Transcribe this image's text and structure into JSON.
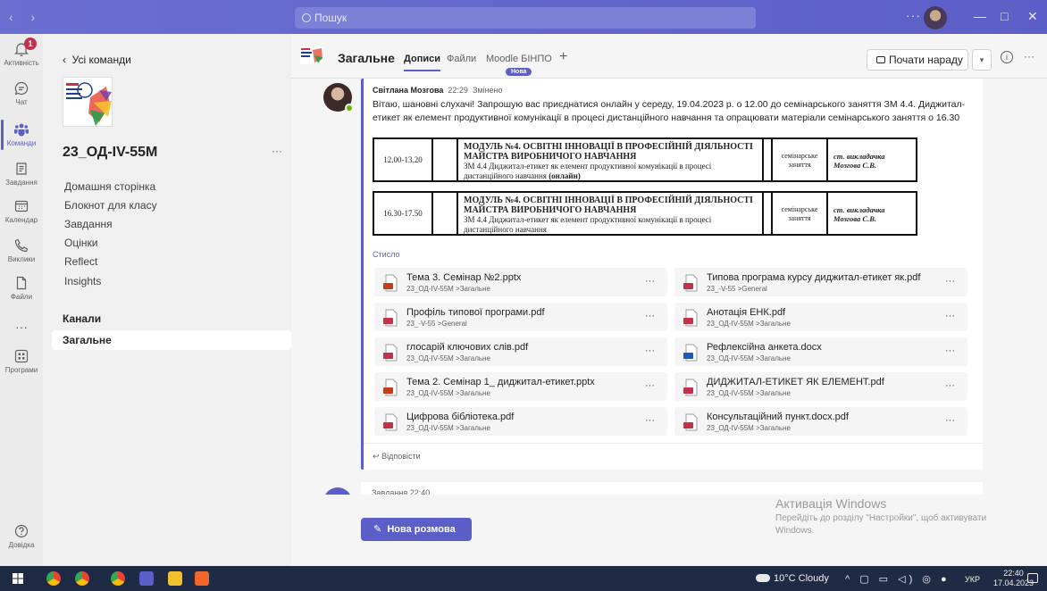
{
  "titlebar": {
    "search_placeholder": "Пошук",
    "nav_arrows": "‹ ›",
    "more": "···",
    "minimize": "—",
    "maximize": "□",
    "close": "✕"
  },
  "rail": [
    {
      "label": "Активність",
      "icon": "bell-icon",
      "badge": "1"
    },
    {
      "label": "Чат",
      "icon": "chat-icon"
    },
    {
      "label": "Команди",
      "icon": "teams-icon",
      "active": true
    },
    {
      "label": "Завдання",
      "icon": "assignments-icon"
    },
    {
      "label": "Календар",
      "icon": "calendar-icon"
    },
    {
      "label": "Виклики",
      "icon": "phone-icon"
    },
    {
      "label": "Файли",
      "icon": "file-icon"
    },
    {
      "label": "···",
      "icon": "more-icon"
    },
    {
      "label": "Програми",
      "icon": "apps-icon"
    },
    {
      "label": "Довідка",
      "icon": "help-icon"
    }
  ],
  "team": {
    "back_label": "Усі команди",
    "name": "23_ОД-IV-55М",
    "more": "···",
    "links": [
      "Домашня сторінка",
      "Блокнот для класу",
      "Завдання",
      "Оцінки",
      "Reflect",
      "Insights"
    ],
    "channels_header": "Канали",
    "active_channel": "Загальне"
  },
  "header": {
    "title": "Загальне",
    "tabs": [
      {
        "label": "Дописи",
        "active": true
      },
      {
        "label": "Файли"
      },
      {
        "label": "Moodle БІНПО"
      }
    ],
    "new_badge": "Нова",
    "add_tab": "+",
    "meet_label": "Почати нараду",
    "info": "i",
    "more": "···"
  },
  "post": {
    "author": "Світлана Мозгова",
    "time": "22:29",
    "edited": "Змінено",
    "text": "Вітаю, шановні слухачі! Запрошую вас приєднатися онлайн у середу, 19.04.2023 р. о 12.00 до семінарського заняття ЗМ 4.4. Диджитал-етикет як елемент продуктивної комунікації в процесі дистанційного навчання та опрацювати матеріали семінарського заняття о 16.30",
    "schedule": [
      {
        "time": "12.00-13.20",
        "title": "МОДУЛЬ №4. ОСВІТНІ ІННОВАЦІЇ В ПРОФЕСІЙНІЙ ДІЯЛЬНОСТІ МАЙСТРА ВИРОБНИЧОГО НАВЧАННЯ",
        "desc": "ЗМ 4.4 Диджитал-етикет як елемент продуктивної комунікації в процесі дистанційного навчання",
        "desc_bold": "(онлайн)",
        "type": "семінарське заняття",
        "teacher": "ст. викладачка Мозгова С.В."
      },
      {
        "time": "16.30-17.50",
        "title": "МОДУЛЬ №4. ОСВІТНІ ІННОВАЦІЇ В ПРОФЕСІЙНІЙ ДІЯЛЬНОСТІ МАЙСТРА ВИРОБНИЧОГО НАВЧАННЯ",
        "desc": "ЗМ 4.4 Диджитал-етикет як елемент продуктивної комунікації в процесі дистанційного навчання",
        "desc_bold": "",
        "type": "семінарське заняття",
        "teacher": "ст. викладачка Мозгова С.В."
      }
    ],
    "collapse_label": "Стисло",
    "files": [
      {
        "name": "Тема 3. Семінар №2.pptx",
        "path": "23_ОД-IV-55М >Загальне",
        "kind": "pptx"
      },
      {
        "name": "Типова програма курсу диджитал-етикет як.pdf",
        "path": "23_-V-55 >General",
        "kind": "pdf"
      },
      {
        "name": "Профіль типової програми.pdf",
        "path": "23_-V-55 >General",
        "kind": "pdf"
      },
      {
        "name": "Анотація ЕНК.pdf",
        "path": "23_ОД-IV-55М >Загальне",
        "kind": "pdf"
      },
      {
        "name": "глосарій ключових слів.pdf",
        "path": "23_ОД-IV-55М >Загальне",
        "kind": "pdf"
      },
      {
        "name": "Рефлексійна анкета.docx",
        "path": "23_ОД-IV-55М >Загальне",
        "kind": "docx"
      },
      {
        "name": "Тема 2. Семінар 1_ диджитал-етикет.pptx",
        "path": "23_ОД-IV-55М >Загальне",
        "kind": "pptx"
      },
      {
        "name": "ДИДЖИТАЛ-ЕТИКЕТ ЯК ЕЛЕМЕНТ.pdf",
        "path": "23_ОД-IV-55М >Загальне",
        "kind": "pdf"
      },
      {
        "name": "Цифрова бібліотека.pdf",
        "path": "23_ОД-IV-55М >Загальне",
        "kind": "pdf"
      },
      {
        "name": "Консультаційний пункт.docx.pdf",
        "path": "23_ОД-IV-55М >Загальне",
        "kind": "pdf"
      }
    ],
    "file_more": "···",
    "reply_label": "Відповісти"
  },
  "post2": {
    "preview": "Завдання 22:40"
  },
  "new_conversation_label": "Нова розмова",
  "watermark": {
    "title": "Активація Windows",
    "subtitle": "Перейдіть до розділу \"Настройки\", щоб активувати Windows."
  },
  "taskbar": {
    "weather": "10°C Cloudy",
    "lang": "УКР",
    "time": "22:40",
    "date": "17.04.2023"
  },
  "colors": {
    "accent": "#5b5fc7",
    "pdf": "#c4314b",
    "pptx": "#c43e1c",
    "docx": "#185abd"
  }
}
